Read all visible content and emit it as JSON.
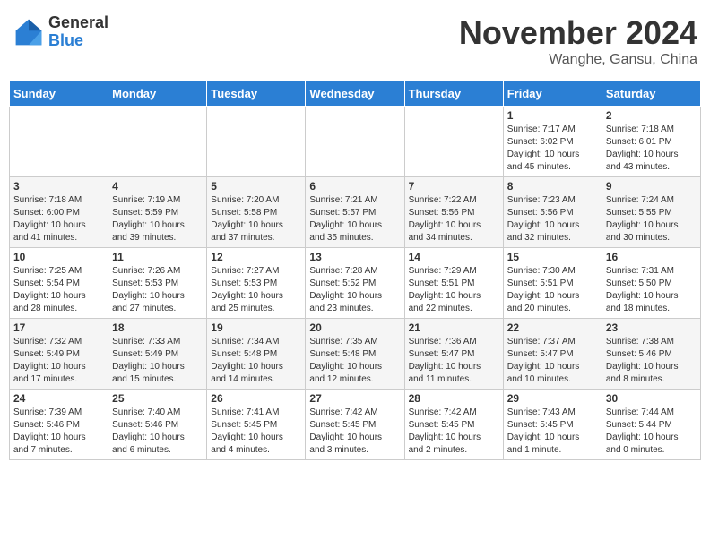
{
  "header": {
    "logo_general": "General",
    "logo_blue": "Blue",
    "month_title": "November 2024",
    "location": "Wanghe, Gansu, China"
  },
  "days_of_week": [
    "Sunday",
    "Monday",
    "Tuesday",
    "Wednesday",
    "Thursday",
    "Friday",
    "Saturday"
  ],
  "weeks": [
    [
      {
        "day": "",
        "info": ""
      },
      {
        "day": "",
        "info": ""
      },
      {
        "day": "",
        "info": ""
      },
      {
        "day": "",
        "info": ""
      },
      {
        "day": "",
        "info": ""
      },
      {
        "day": "1",
        "info": "Sunrise: 7:17 AM\nSunset: 6:02 PM\nDaylight: 10 hours\nand 45 minutes."
      },
      {
        "day": "2",
        "info": "Sunrise: 7:18 AM\nSunset: 6:01 PM\nDaylight: 10 hours\nand 43 minutes."
      }
    ],
    [
      {
        "day": "3",
        "info": "Sunrise: 7:18 AM\nSunset: 6:00 PM\nDaylight: 10 hours\nand 41 minutes."
      },
      {
        "day": "4",
        "info": "Sunrise: 7:19 AM\nSunset: 5:59 PM\nDaylight: 10 hours\nand 39 minutes."
      },
      {
        "day": "5",
        "info": "Sunrise: 7:20 AM\nSunset: 5:58 PM\nDaylight: 10 hours\nand 37 minutes."
      },
      {
        "day": "6",
        "info": "Sunrise: 7:21 AM\nSunset: 5:57 PM\nDaylight: 10 hours\nand 35 minutes."
      },
      {
        "day": "7",
        "info": "Sunrise: 7:22 AM\nSunset: 5:56 PM\nDaylight: 10 hours\nand 34 minutes."
      },
      {
        "day": "8",
        "info": "Sunrise: 7:23 AM\nSunset: 5:56 PM\nDaylight: 10 hours\nand 32 minutes."
      },
      {
        "day": "9",
        "info": "Sunrise: 7:24 AM\nSunset: 5:55 PM\nDaylight: 10 hours\nand 30 minutes."
      }
    ],
    [
      {
        "day": "10",
        "info": "Sunrise: 7:25 AM\nSunset: 5:54 PM\nDaylight: 10 hours\nand 28 minutes."
      },
      {
        "day": "11",
        "info": "Sunrise: 7:26 AM\nSunset: 5:53 PM\nDaylight: 10 hours\nand 27 minutes."
      },
      {
        "day": "12",
        "info": "Sunrise: 7:27 AM\nSunset: 5:53 PM\nDaylight: 10 hours\nand 25 minutes."
      },
      {
        "day": "13",
        "info": "Sunrise: 7:28 AM\nSunset: 5:52 PM\nDaylight: 10 hours\nand 23 minutes."
      },
      {
        "day": "14",
        "info": "Sunrise: 7:29 AM\nSunset: 5:51 PM\nDaylight: 10 hours\nand 22 minutes."
      },
      {
        "day": "15",
        "info": "Sunrise: 7:30 AM\nSunset: 5:51 PM\nDaylight: 10 hours\nand 20 minutes."
      },
      {
        "day": "16",
        "info": "Sunrise: 7:31 AM\nSunset: 5:50 PM\nDaylight: 10 hours\nand 18 minutes."
      }
    ],
    [
      {
        "day": "17",
        "info": "Sunrise: 7:32 AM\nSunset: 5:49 PM\nDaylight: 10 hours\nand 17 minutes."
      },
      {
        "day": "18",
        "info": "Sunrise: 7:33 AM\nSunset: 5:49 PM\nDaylight: 10 hours\nand 15 minutes."
      },
      {
        "day": "19",
        "info": "Sunrise: 7:34 AM\nSunset: 5:48 PM\nDaylight: 10 hours\nand 14 minutes."
      },
      {
        "day": "20",
        "info": "Sunrise: 7:35 AM\nSunset: 5:48 PM\nDaylight: 10 hours\nand 12 minutes."
      },
      {
        "day": "21",
        "info": "Sunrise: 7:36 AM\nSunset: 5:47 PM\nDaylight: 10 hours\nand 11 minutes."
      },
      {
        "day": "22",
        "info": "Sunrise: 7:37 AM\nSunset: 5:47 PM\nDaylight: 10 hours\nand 10 minutes."
      },
      {
        "day": "23",
        "info": "Sunrise: 7:38 AM\nSunset: 5:46 PM\nDaylight: 10 hours\nand 8 minutes."
      }
    ],
    [
      {
        "day": "24",
        "info": "Sunrise: 7:39 AM\nSunset: 5:46 PM\nDaylight: 10 hours\nand 7 minutes."
      },
      {
        "day": "25",
        "info": "Sunrise: 7:40 AM\nSunset: 5:46 PM\nDaylight: 10 hours\nand 6 minutes."
      },
      {
        "day": "26",
        "info": "Sunrise: 7:41 AM\nSunset: 5:45 PM\nDaylight: 10 hours\nand 4 minutes."
      },
      {
        "day": "27",
        "info": "Sunrise: 7:42 AM\nSunset: 5:45 PM\nDaylight: 10 hours\nand 3 minutes."
      },
      {
        "day": "28",
        "info": "Sunrise: 7:42 AM\nSunset: 5:45 PM\nDaylight: 10 hours\nand 2 minutes."
      },
      {
        "day": "29",
        "info": "Sunrise: 7:43 AM\nSunset: 5:45 PM\nDaylight: 10 hours\nand 1 minute."
      },
      {
        "day": "30",
        "info": "Sunrise: 7:44 AM\nSunset: 5:44 PM\nDaylight: 10 hours\nand 0 minutes."
      }
    ]
  ]
}
